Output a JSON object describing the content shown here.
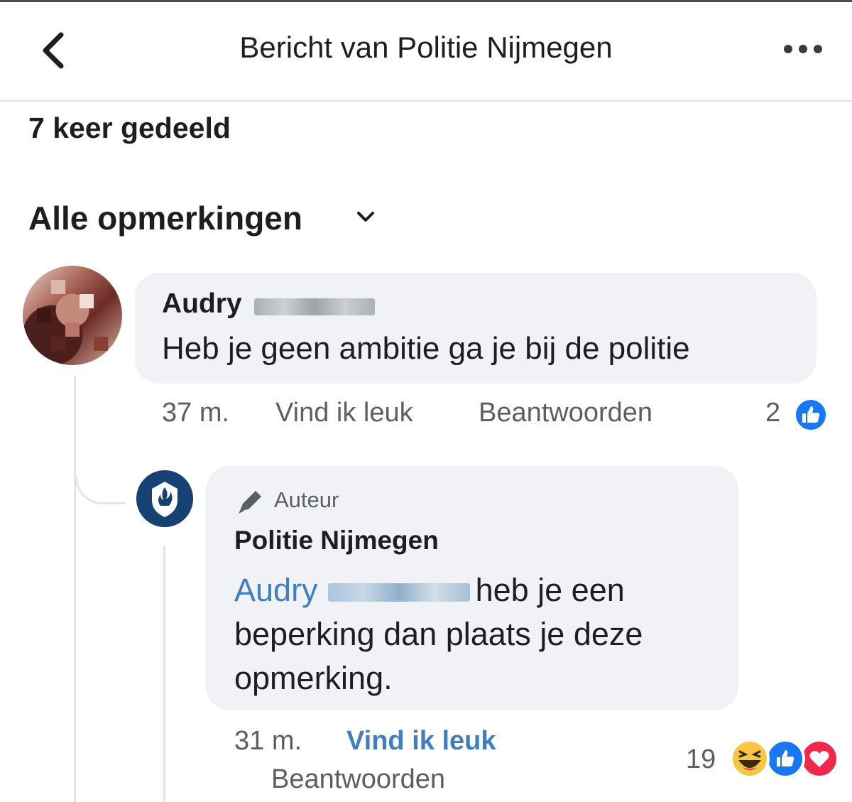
{
  "header": {
    "title": "Bericht van Politie Nijmegen",
    "back_icon": "chevron-left-icon",
    "more_icon": "more-horizontal-icon"
  },
  "post": {
    "shares": "7 keer gedeeld"
  },
  "comments_filter": {
    "label": "Alle opmerkingen",
    "icon": "chevron-down-icon"
  },
  "comment": {
    "author": "Audry",
    "text": "Heb je geen ambitie ga je bij de politie",
    "time": "37 m.",
    "like_label": "Vind ik leuk",
    "reply_label": "Beantwoorden",
    "reaction_count": "2",
    "reaction_icons": [
      "like-icon"
    ]
  },
  "reply": {
    "badge": "Auteur",
    "author": "Politie Nijmegen",
    "mention": "Audry",
    "text_part1": "heb je een",
    "text_part2": "beperking dan plaats je deze",
    "text_part3": "opmerking.",
    "time": "31 m.",
    "like_label": "Vind ik leuk",
    "reply_label": "Beantwoorden",
    "reaction_count": "19",
    "reaction_icons": [
      "haha-icon",
      "like-icon",
      "love-icon"
    ]
  },
  "colors": {
    "bubble": "#f0f2f5",
    "link": "#3f7fc1",
    "like_blue": "#1877f2",
    "love_red": "#f0284a",
    "haha_yellow": "#f7c744",
    "police_blue": "#154273"
  }
}
